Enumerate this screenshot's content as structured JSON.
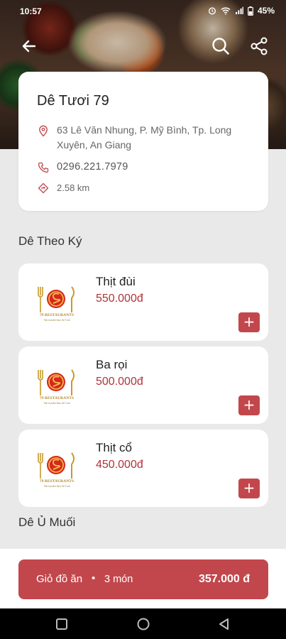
{
  "status_bar": {
    "time": "10:57",
    "battery": "45%"
  },
  "restaurant": {
    "name": "Dê Tươi 79",
    "address": "63 Lê Văn Nhung, P. Mỹ Bình, Tp. Long Xuyên, An Giang",
    "phone": "0296.221.7979",
    "distance": "2.58 km"
  },
  "sections": [
    {
      "title": "Dê Theo Ký",
      "items": [
        {
          "name": "Thịt đùi",
          "price": "550.000đ",
          "add_label": "+"
        },
        {
          "name": "Ba rọi",
          "price": "500.000đ",
          "add_label": "+"
        },
        {
          "name": "Thịt cổ",
          "price": "450.000đ",
          "add_label": "+"
        }
      ]
    },
    {
      "title": "Dê Ủ Muối",
      "items": []
    }
  ],
  "cart": {
    "label": "Giỏ đồ ăn",
    "separator": "•",
    "count": "3 món",
    "total": "357.000 đ"
  },
  "colors": {
    "accent": "#c2474c",
    "price": "#b0333a",
    "background": "#e9e9e9"
  },
  "icons": [
    "back-arrow-icon",
    "search-icon",
    "share-icon",
    "location-pin-icon",
    "phone-icon",
    "distance-icon",
    "restaurant-logo",
    "plus-icon"
  ]
}
